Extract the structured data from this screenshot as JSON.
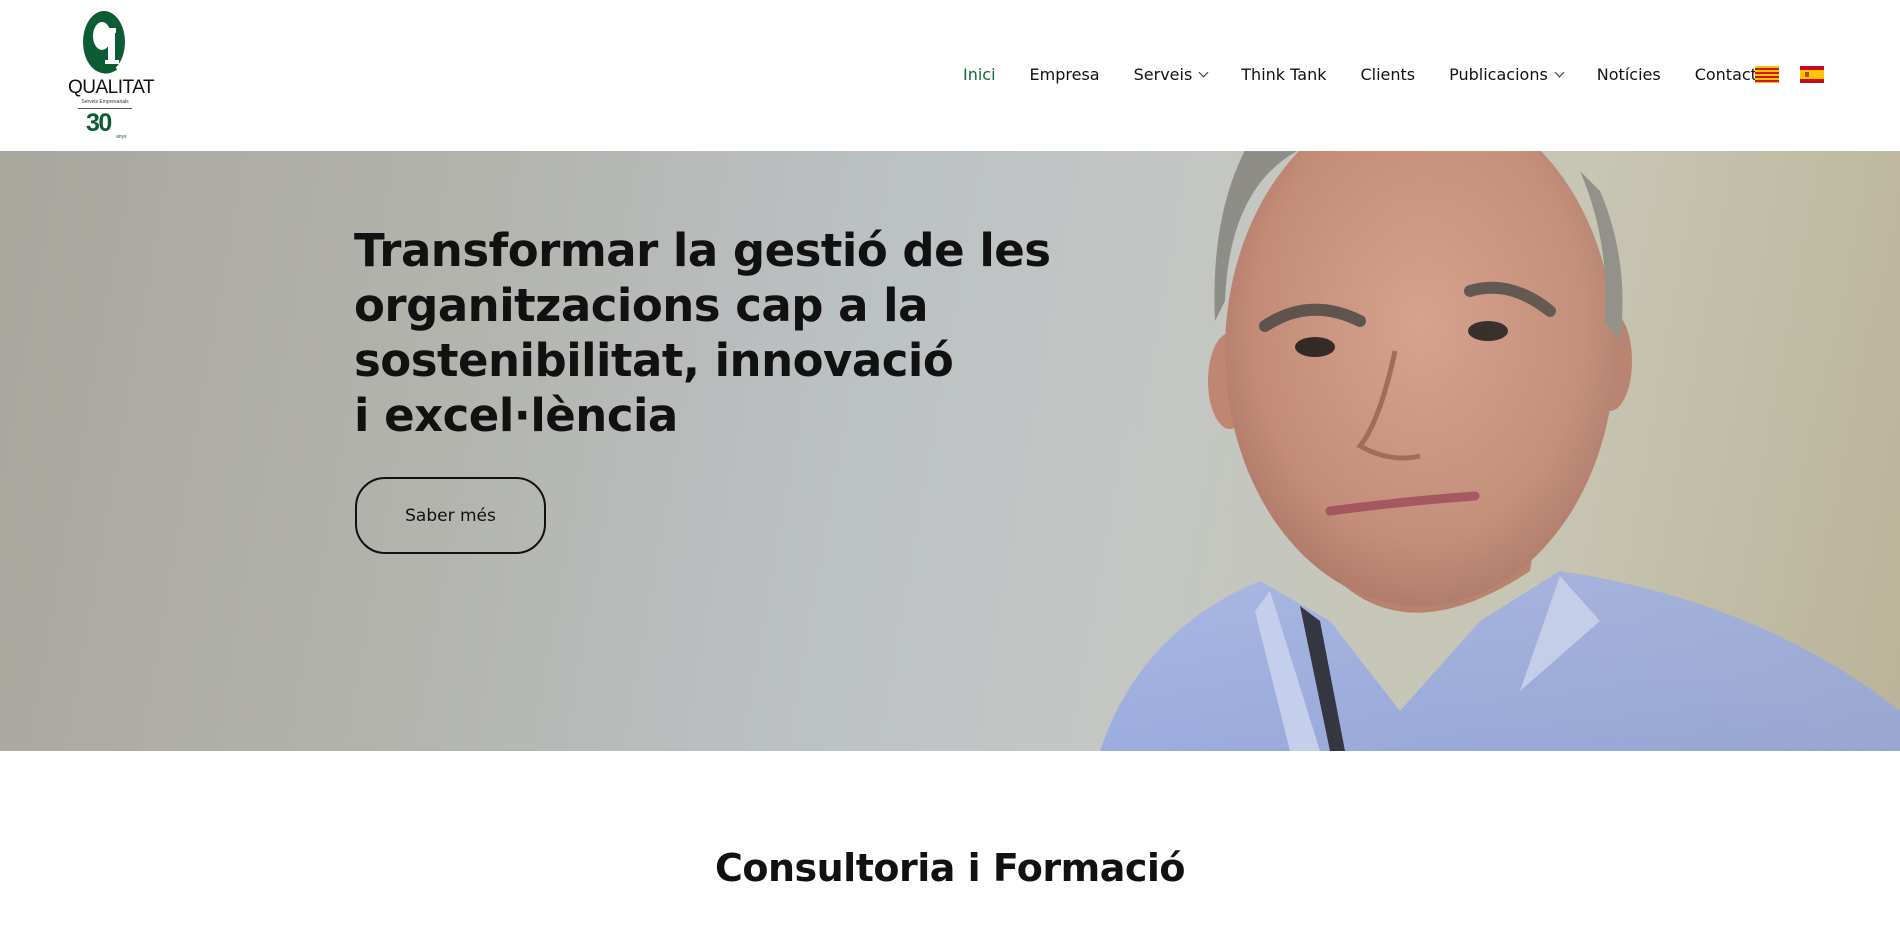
{
  "header": {
    "logo": {
      "brand": "QUALITAT",
      "tagline": "Serveis Empresarials",
      "years": "30",
      "years_suffix": "anys",
      "colors": {
        "green": "#0d5c34"
      }
    },
    "nav": {
      "items": [
        {
          "label": "Inici",
          "active": true
        },
        {
          "label": "Empresa"
        },
        {
          "label": "Serveis",
          "dropdown": true
        },
        {
          "label": "Think Tank"
        },
        {
          "label": "Clients"
        },
        {
          "label": "Publicacions",
          "dropdown": true
        },
        {
          "label": "Notícies"
        },
        {
          "label": "Contacte"
        }
      ],
      "languages": [
        {
          "icon": "flag-catalonia-icon"
        },
        {
          "icon": "flag-spain-icon"
        }
      ],
      "active_color": "#0d6b3a"
    }
  },
  "hero": {
    "title_lines": [
      "Transformar la gestió de les",
      "organitzacions cap a la",
      "sostenibilitat, innovació",
      "i excel·lència"
    ],
    "button_label": "Saber més"
  },
  "section": {
    "title": "Consultoria i Formació"
  }
}
